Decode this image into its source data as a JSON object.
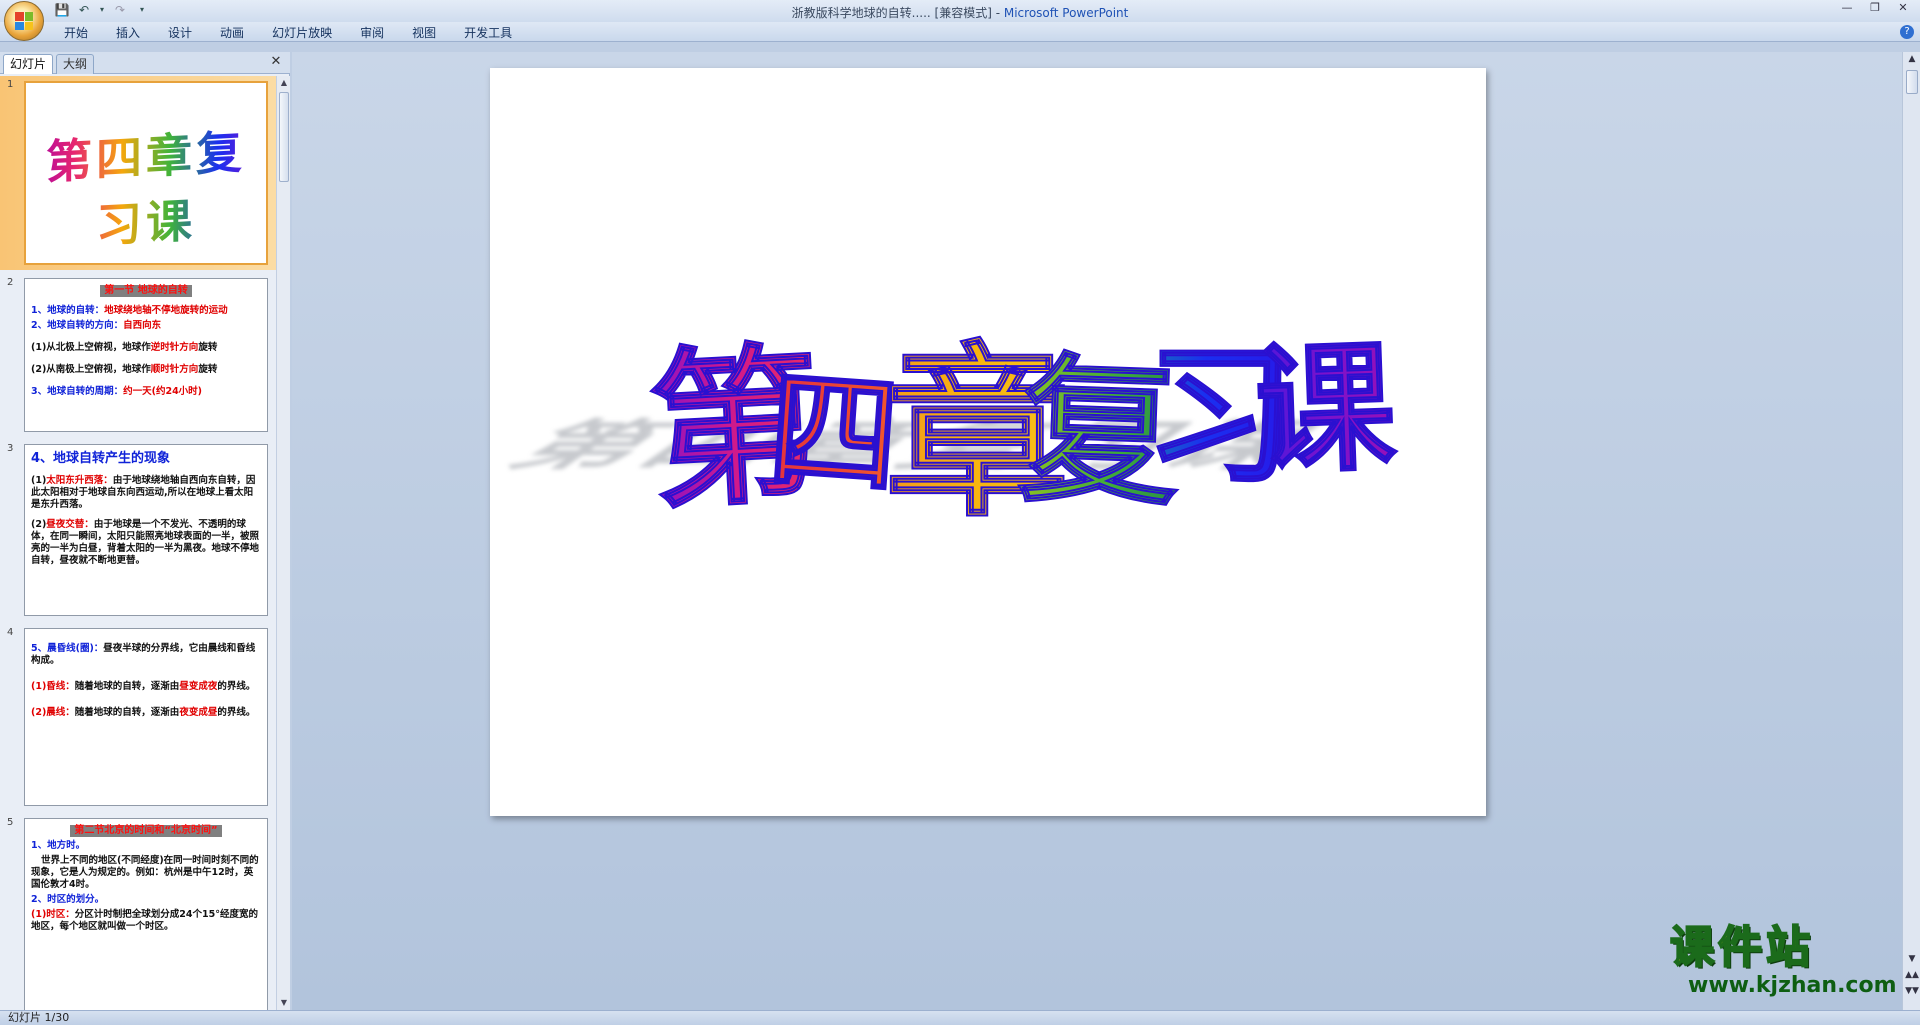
{
  "window": {
    "title_doc": "浙教版科学地球的自转..... [兼容模式]",
    "title_sep": " - ",
    "title_app": "Microsoft PowerPoint"
  },
  "ribbon": {
    "tabs": [
      "开始",
      "插入",
      "设计",
      "动画",
      "幻灯片放映",
      "审阅",
      "视图",
      "开发工具"
    ]
  },
  "left_pane": {
    "tab_slides": "幻灯片",
    "tab_outline": "大纲"
  },
  "slides": [
    {
      "num": "1",
      "title": "第四章复习课"
    },
    {
      "num": "2",
      "header": "第一节 地球的自转",
      "l1_label": "1、地球的自转：",
      "l1_value": "地球绕地轴不停地旋转的运动",
      "l2_label": "2、地球自转的方向：",
      "l2_value": "自西向东",
      "l3_pre": "(1)从北极上空俯视，地球作",
      "l3_val": "逆时针方向",
      "l3_post": "旋转",
      "l4_pre": "(2)从南极上空俯视，地球作",
      "l4_val": "顺时针方向",
      "l4_post": "旋转",
      "l5_label": "3、地球自转的周期：",
      "l5_value": "约一天(约24小时)"
    },
    {
      "num": "3",
      "header": "4、地球自转产生的现象",
      "p1_num": "(1)",
      "p1_label": "太阳东升西落：",
      "p1_text": "由于地球绕地轴自西向东自转，因此太阳相对于地球自东向西运动,所以在地球上看太阳是东升西落。",
      "p2_num": "(2)",
      "p2_label": "昼夜交替：",
      "p2_text": "由于地球是一个不发光、不透明的球体，在同一瞬间，太阳只能照亮地球表面的一半，被照亮的一半为白昼，背着太阳的一半为黑夜。地球不停地自转，昼夜就不断地更替。"
    },
    {
      "num": "4",
      "l1_label": "5、晨昏线(圈)：",
      "l1_text": "昼夜半球的分界线，它由晨线和昏线构成。",
      "l2_label": "(1)昏线：",
      "l2_pre": "随着地球的自转，逐渐由",
      "l2_val": "昼变成夜",
      "l2_post": "的界线。",
      "l3_label": "(2)晨线：",
      "l3_pre": "随着地球的自转，逐渐由",
      "l3_val": "夜变成昼",
      "l3_post": "的界线。"
    },
    {
      "num": "5",
      "header": "第二节北京的时间和“北京时间”",
      "l1_label": "1、地方时。",
      "l1_text": "世界上不同的地区(不同经度)在同一时间时刻不同的现象，它是人为规定的。例如：杭州是中午12时，英国伦敦才4时。",
      "l2_label": "2、时区的划分。",
      "l3_label": "(1)时区：",
      "l3_text": "分区计时制把全球划分成24个15°经度宽的地区，每个地区就叫做一个时区。"
    }
  ],
  "main_slide": {
    "title_chars": [
      "第",
      "四",
      "章",
      "复",
      "习",
      "课"
    ]
  },
  "status": {
    "text": "幻灯片 1/30"
  },
  "watermark": {
    "cn": "课件站",
    "url": "www.kjzhan.com"
  },
  "colors": {
    "selected_slide": "#f9c474",
    "title_gradient": [
      "#a100b0",
      "#e62570",
      "#f5a70d",
      "#40b33a",
      "#1a2ff0",
      "#8a10c9"
    ]
  }
}
